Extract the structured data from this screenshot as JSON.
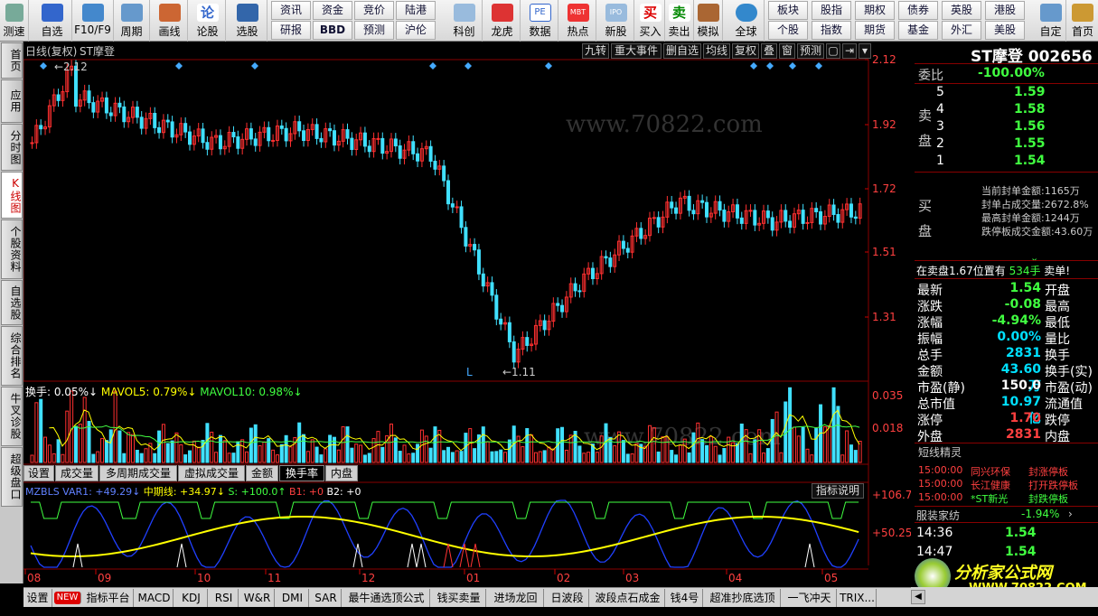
{
  "toolbar": {
    "groups": [
      {
        "label": "测速"
      },
      {
        "label": "自选"
      },
      {
        "label": "F10/F9"
      },
      {
        "label": "周期"
      },
      {
        "label": "画线"
      },
      {
        "label": "论股"
      },
      {
        "label": "选股"
      }
    ],
    "grid_top": [
      "资讯",
      "资金",
      "竞价",
      "陆港"
    ],
    "grid_bottom": [
      "研报",
      "BBD",
      "预测",
      "沪伦"
    ],
    "groups2": [
      {
        "label": "科创"
      },
      {
        "label": "龙虎"
      },
      {
        "label": "数据"
      },
      {
        "label": "热点"
      },
      {
        "label": "新股"
      },
      {
        "label": "买入"
      },
      {
        "label": "卖出"
      },
      {
        "label": "模拟"
      },
      {
        "label": "全球"
      }
    ],
    "grid2_top": [
      "板块",
      "股指",
      "期权",
      "债券",
      "英股",
      "港股"
    ],
    "grid2_bottom": [
      "个股",
      "指数",
      "期货",
      "基金",
      "外汇",
      "美股"
    ],
    "right": [
      {
        "label": "自定"
      },
      {
        "label": "首页"
      }
    ],
    "icon_text": [
      "论",
      "PE",
      "MBT",
      "IPO",
      "买",
      "卖"
    ]
  },
  "sidebar": [
    "首页",
    "应用",
    "分时图",
    "K线图",
    "个股资料",
    "自选股",
    "综合排名",
    "牛叉诊股",
    "超级盘口"
  ],
  "chart": {
    "header": {
      "period": "日线(复权)",
      "name": "ST摩登"
    },
    "buttons": [
      "九转",
      "重大事件",
      "删自选",
      "均线",
      "复权",
      "叠",
      "窗",
      "预测"
    ],
    "price_labels": [
      "2.12",
      "1.92",
      "1.72",
      "1.51",
      "1.31"
    ],
    "max_label": "2.12",
    "min_label": "1.11",
    "L_marker": "L",
    "vol_legend": {
      "a": "换手: 0.05%↓",
      "b": "MAVOL5: 0.79%↓",
      "c": "MAVOL10: 0.98%↓"
    },
    "vol_labels": [
      "0.035",
      "0.018"
    ],
    "tabs": [
      "设置",
      "成交量",
      "多周期成交量",
      "虚拟成交量",
      "金额",
      "换手率",
      "内盘"
    ],
    "ind_legend": {
      "a": "MZBLS VAR1: +49.29↓",
      "b": "中期线: +34.97↓",
      "c": "S: +100.0↑",
      "d": "B1: +0",
      "e": "B2: +0"
    },
    "ind_btn": "指标说明",
    "ind_labels": [
      "+106.7",
      "+50.25"
    ],
    "months": [
      "08",
      "09",
      "10",
      "11",
      "12",
      "01",
      "02",
      "03",
      "04",
      "05"
    ],
    "watermark": "www.70822.com"
  },
  "right": {
    "title": "ST摩登 002656",
    "weibi_label": "委比",
    "weibi": "-100.00%",
    "sell_label": "卖盘",
    "buy_label": "买盘",
    "asks": [
      {
        "n": "5",
        "p": "1.59"
      },
      {
        "n": "4",
        "p": "1.58"
      },
      {
        "n": "3",
        "p": "1.56"
      },
      {
        "n": "2",
        "p": "1.55"
      },
      {
        "n": "1",
        "p": "1.54"
      }
    ],
    "seal": [
      "当前封单金额:1165万",
      "封单占成交量:2672.8%",
      "最高封单金额:1244万",
      "跌停板成交金额:43.60万"
    ],
    "status": {
      "a": "在卖盘1.67位置有",
      "b": "534手",
      "c": "卖单!"
    },
    "quotes": [
      {
        "l": "最新",
        "v": "1.54",
        "c": "grn",
        "r": "开盘",
        "rv": ""
      },
      {
        "l": "涨跌",
        "v": "-0.08",
        "c": "grn",
        "r": "最高",
        "rv": ""
      },
      {
        "l": "涨幅",
        "v": "-4.94%",
        "c": "grn",
        "r": "最低",
        "rv": ""
      },
      {
        "l": "振幅",
        "v": "0.00%",
        "c": "cy",
        "r": "量比",
        "rv": ""
      },
      {
        "l": "总手",
        "v": "2831",
        "c": "cy",
        "r": "换手",
        "rv": ""
      },
      {
        "l": "金额",
        "v": "43.60万",
        "c": "cy",
        "r": "换手(实)",
        "rv": ""
      },
      {
        "l": "市盈(静)",
        "v": "150.0",
        "c": "wht",
        "r": "市盈(动)",
        "rv": ""
      },
      {
        "l": "总市值",
        "v": "10.97亿",
        "c": "cy",
        "r": "流通值",
        "rv": ""
      },
      {
        "l": "涨停",
        "v": "1.70",
        "c": "red",
        "r": "跌停",
        "rv": ""
      },
      {
        "l": "外盘",
        "v": "2831",
        "c": "red",
        "r": "内盘",
        "rv": ""
      }
    ],
    "short_title": "短线精灵",
    "short": [
      {
        "t": "15:00:00",
        "n": "同兴环保",
        "e": "封涨停板"
      },
      {
        "t": "15:00:00",
        "n": "长江健康",
        "e": "打开跌停板"
      },
      {
        "t": "15:00:00",
        "n": "*ST新光",
        "e": "封跌停板"
      }
    ],
    "sector": {
      "n": "服装家纺",
      "v": "-1.94%"
    },
    "ticks": [
      {
        "t": "14:36",
        "v": "1.54"
      },
      {
        "t": "14:47",
        "v": "1.54"
      }
    ],
    "logo": "分析家公式网",
    "logo_url": "WWW.70822.COM"
  },
  "bottom": [
    "设置",
    "NEW",
    "指标平台",
    "MACD",
    "KDJ",
    "RSI",
    "W&R",
    "DMI",
    "SAR",
    "最牛通选顶公式",
    "钱买卖量",
    "进场龙回",
    "日波段",
    "波段点石成金",
    "钱4号",
    "超准抄底选顶",
    "一飞冲天",
    "TRIX..."
  ],
  "colors": {
    "up": "#ff3030",
    "down": "#40e0ff",
    "ma": "#ffff00",
    "ind_blue": "#2040ff",
    "ind_green": "#40ff40"
  }
}
